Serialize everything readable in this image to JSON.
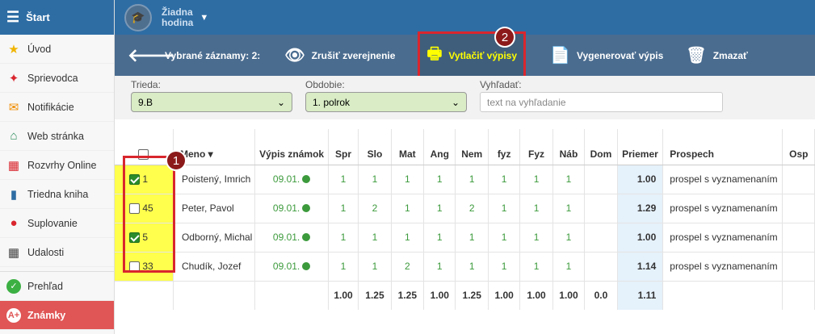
{
  "sidebar": {
    "title": "Štart",
    "items": [
      {
        "label": "Úvod",
        "icon": "star-icon"
      },
      {
        "label": "Sprievodca",
        "icon": "wand-icon"
      },
      {
        "label": "Notifikácie",
        "icon": "envelope-icon"
      },
      {
        "label": "Web stránka",
        "icon": "house-icon"
      },
      {
        "label": "Rozvrhy Online",
        "icon": "calendar-icon"
      },
      {
        "label": "Triedna kniha",
        "icon": "book-icon"
      },
      {
        "label": "Suplovanie",
        "icon": "person-icon"
      },
      {
        "label": "Udalosti",
        "icon": "calendar-grid-icon"
      },
      {
        "label": "Prehľad",
        "icon": "check-circle-icon"
      },
      {
        "label": "Známky",
        "icon": "grades-icon"
      }
    ]
  },
  "topbar": {
    "hour_line1": "Žiadna",
    "hour_line2": "hodina"
  },
  "toolbar": {
    "selected_label": "Vybrané záznamy: 2:",
    "unpublish_label": "Zrušiť zverejnenie",
    "print_label": "Vytlačiť výpisy",
    "generate_label": "Vygenerovať výpis",
    "delete_label": "Zmazať"
  },
  "badges": {
    "one": "1",
    "two": "2"
  },
  "filters": {
    "class_label": "Trieda:",
    "class_value": "9.B",
    "period_label": "Obdobie:",
    "period_value": "1. polrok",
    "search_label": "Vyhľadať:",
    "search_placeholder": "text na vyhľadanie"
  },
  "table": {
    "headers": [
      "Meno",
      "Výpis známok",
      "Spr",
      "Slo",
      "Mat",
      "Ang",
      "Nem",
      "fyz",
      "Fyz",
      "Náb",
      "Dom",
      "Priemer",
      "Prospech",
      "Osp"
    ],
    "rows": [
      {
        "id": "1",
        "checked": true,
        "name": "Poistený, Imrich",
        "pub": "09.01.",
        "grades": [
          "1",
          "1",
          "1",
          "1",
          "1",
          "1",
          "1",
          "1",
          ""
        ],
        "avg": "1.00",
        "result": "prospel s vyznamenaním"
      },
      {
        "id": "45",
        "checked": false,
        "name": "Peter, Pavol",
        "pub": "09.01.",
        "grades": [
          "1",
          "2",
          "1",
          "1",
          "2",
          "1",
          "1",
          "1",
          ""
        ],
        "avg": "1.29",
        "result": "prospel s vyznamenaním"
      },
      {
        "id": "5",
        "checked": true,
        "name": "Odborný, Michal",
        "pub": "09.01.",
        "grades": [
          "1",
          "1",
          "1",
          "1",
          "1",
          "1",
          "1",
          "1",
          ""
        ],
        "avg": "1.00",
        "result": "prospel s vyznamenaním"
      },
      {
        "id": "33",
        "checked": false,
        "name": "Chudík, Jozef",
        "pub": "09.01.",
        "grades": [
          "1",
          "1",
          "2",
          "1",
          "1",
          "1",
          "1",
          "1",
          ""
        ],
        "avg": "1.14",
        "result": "prospel s vyznamenaním"
      }
    ],
    "footer": [
      "1.00",
      "1.25",
      "1.25",
      "1.00",
      "1.25",
      "1.00",
      "1.00",
      "1.00",
      "0.0",
      "1.11"
    ]
  },
  "colors": {
    "primary": "#2e6da4",
    "toolbar": "#4a6c8f",
    "highlight": "#ffff4d",
    "red": "#d9262e",
    "active": "#e05555"
  }
}
